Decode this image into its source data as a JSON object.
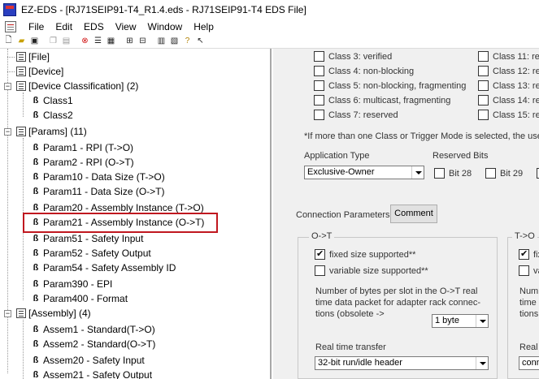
{
  "window": {
    "title": "EZ-EDS - [RJ71SEIP91-T4_R1.4.eds - RJ71SEIP91-T4 EDS File]"
  },
  "menu": {
    "items": [
      {
        "label": "File"
      },
      {
        "label": "Edit"
      },
      {
        "label": "EDS"
      },
      {
        "label": "View"
      },
      {
        "label": "Window"
      },
      {
        "label": "Help"
      }
    ]
  },
  "toolbar": {
    "icons": [
      "new-icon",
      "open-icon",
      "save-icon",
      "copy-icon",
      "paste-icon",
      "stop-icon",
      "list-icon",
      "grid-icon",
      "tree-icon",
      "tree2-icon",
      "help-book-icon",
      "page-icon",
      "question-icon",
      "context-help-icon"
    ]
  },
  "tree": {
    "file": "[File]",
    "device": "[Device]",
    "device_classification": "[Device Classification] (2)",
    "class1": "Class1",
    "class2": "Class2",
    "params": "[Params] (11)",
    "param_items": [
      "Param1 - RPI (T->O)",
      "Param2 - RPI (O->T)",
      "Param10 - Data Size (T->O)",
      "Param11 - Data Size (O->T)",
      "Param20 - Assembly Instance (T->O)",
      "Param21 - Assembly Instance (O->T)",
      "Param51 - Safety Input",
      "Param52 - Safety Output",
      "Param54 - Safety Assembly ID",
      "Param390 - EPI",
      "Param400 - Format"
    ],
    "assembly": "[Assembly] (4)",
    "assem_items": [
      "Assem1 - Standard(T->O)",
      "Assem2 - Standard(O->T)",
      "Assem20 - Safety Input",
      "Assem21 - Safety Output"
    ]
  },
  "classes_left": [
    {
      "label": "Class 3: verified",
      "checked": false
    },
    {
      "label": "Class 4: non-blocking",
      "checked": false
    },
    {
      "label": "Class 5: non-blocking, fragmenting",
      "checked": false
    },
    {
      "label": "Class 6: multicast, fragmenting",
      "checked": false
    },
    {
      "label": "Class 7: reserved",
      "checked": false
    }
  ],
  "classes_right": [
    {
      "label": "Class 11: res",
      "checked": false
    },
    {
      "label": "Class 12: res",
      "checked": false
    },
    {
      "label": "Class 13: res",
      "checked": false
    },
    {
      "label": "Class 14: res",
      "checked": false
    },
    {
      "label": "Class 15: res",
      "checked": false
    }
  ],
  "note": "*If more than one Class or Trigger Mode is selected, the user m",
  "application_type": {
    "label": "Application Type",
    "value": "Exclusive-Owner"
  },
  "reserved_bits": {
    "label": "Reserved Bits",
    "bit28": "Bit 28",
    "bit29": "Bit 29"
  },
  "connection_params": {
    "label": "Connection Parameters",
    "comment_button": "Comment"
  },
  "ot_group": {
    "title": "O->T",
    "fixed": "fixed size supported**",
    "fixed_checked": true,
    "variable": "variable size supported**",
    "variable_checked": false,
    "bytes_text_1": "Number of bytes per slot in the O->T real",
    "bytes_text_2": "time data packet for adapter rack connec-",
    "bytes_text_3": "tions (obsolete ->",
    "bytes_value": "1 byte",
    "rt_label": "Real time transfer",
    "rt_value": "32-bit run/idle header"
  },
  "to_group": {
    "title": "T->O",
    "fixed": "fix",
    "variable": "va",
    "text_1": "Numb",
    "text_2": "time d",
    "text_3": "tions (",
    "rt_label": "Real t",
    "rt_value": "conn"
  }
}
